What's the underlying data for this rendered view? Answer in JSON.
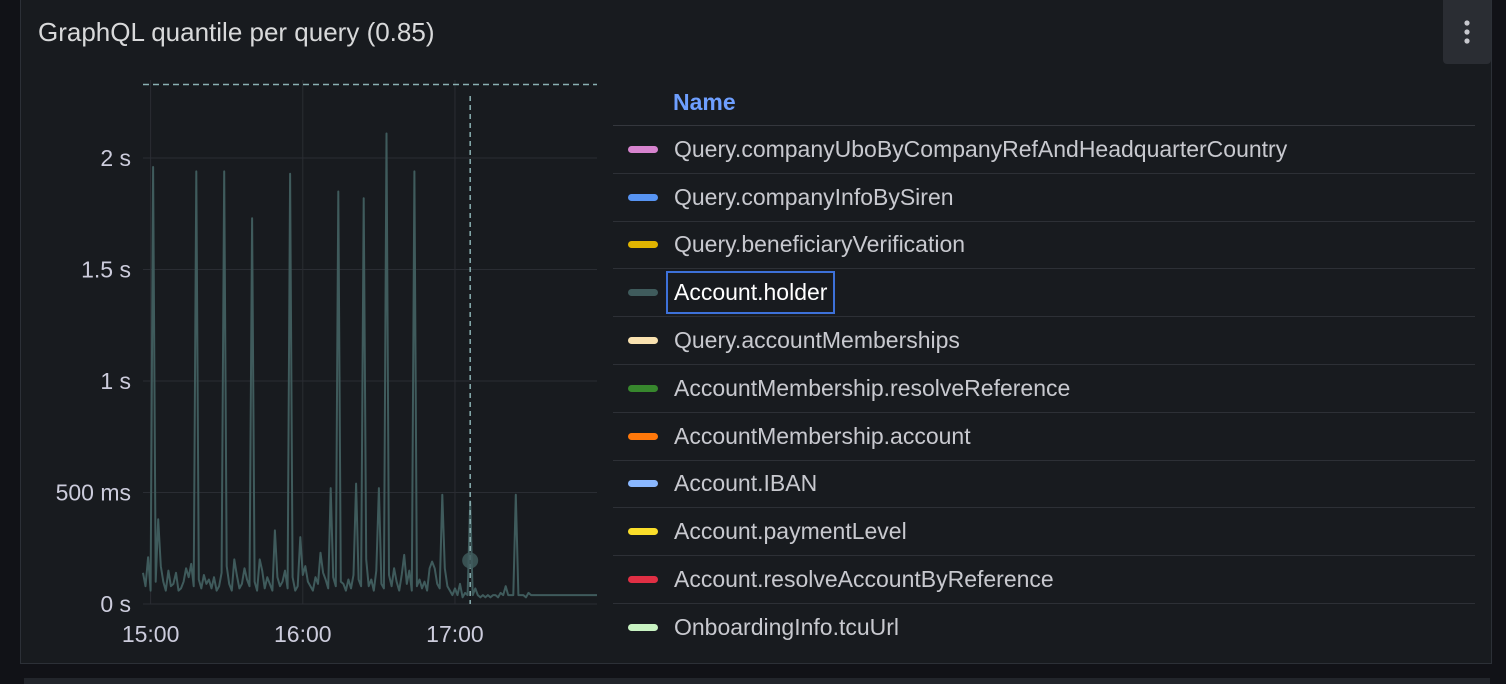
{
  "panel": {
    "title": "GraphQL quantile per query (0.85)",
    "menu_icon": "kebab-vertical-icon"
  },
  "legend": {
    "header": "Name",
    "items": [
      {
        "label": "Query.companyUboByCompanyRefAndHeadquarterCountry",
        "color": "#d683ce"
      },
      {
        "label": "Query.companyInfoBySiren",
        "color": "#5794f2"
      },
      {
        "label": "Query.beneficiaryVerification",
        "color": "#e0b400"
      },
      {
        "label": "Account.holder",
        "color": "#3f5b5c",
        "focused": true
      },
      {
        "label": "Query.accountMemberships",
        "color": "#f9e2b0"
      },
      {
        "label": "AccountMembership.resolveReference",
        "color": "#37872d"
      },
      {
        "label": "AccountMembership.account",
        "color": "#ff780a"
      },
      {
        "label": "Account.IBAN",
        "color": "#8ab8ff"
      },
      {
        "label": "Account.paymentLevel",
        "color": "#fade2a"
      },
      {
        "label": "Account.resolveAccountByReference",
        "color": "#e02f44"
      },
      {
        "label": "OnboardingInfo.tcuUrl",
        "color": "#c8f2c2"
      }
    ]
  },
  "chart_data": {
    "type": "line",
    "ylabel": "",
    "xlabel": "",
    "y_ticks": [
      "0 s",
      "500 ms",
      "1 s",
      "1.5 s",
      "2 s"
    ],
    "y_tick_values_ms": [
      0,
      500,
      1000,
      1500,
      2000
    ],
    "x_ticks": [
      "15:00",
      "16:00",
      "17:00"
    ],
    "ylim_ms": [
      0,
      2350
    ],
    "xlim": [
      "14:57",
      "17:57"
    ],
    "grid": true,
    "threshold_ms": 2330,
    "cursor_time": "17:06",
    "cursor_value_ms": 195,
    "series": [
      {
        "name": "Account.holder",
        "color": "#3f5b5c",
        "time_min": [
          0,
          1,
          2,
          3,
          4,
          5,
          6,
          7,
          8,
          9,
          10,
          11,
          12,
          13,
          14,
          15,
          16,
          17,
          18,
          19,
          20,
          21,
          22,
          23,
          24,
          25,
          26,
          27,
          28,
          29,
          30,
          31,
          32,
          33,
          34,
          35,
          36,
          37,
          38,
          39,
          40,
          41,
          42,
          43,
          44,
          45,
          46,
          47,
          48,
          49,
          50,
          51,
          52,
          53,
          54,
          55,
          56,
          57,
          58,
          59,
          60,
          61,
          62,
          63,
          64,
          65,
          66,
          67,
          68,
          69,
          70,
          71,
          72,
          73,
          74,
          75,
          76,
          77,
          78,
          79,
          80,
          81,
          82,
          83,
          84,
          85,
          86,
          87,
          88,
          89,
          90,
          91,
          92,
          93,
          94,
          95,
          96,
          97,
          98,
          99,
          100,
          101,
          102,
          103,
          104,
          105,
          106,
          107,
          108,
          109,
          110,
          111,
          112,
          113,
          114,
          115,
          116,
          117,
          118,
          119,
          120,
          121,
          122,
          123,
          124,
          125,
          126,
          127,
          128,
          129,
          130,
          131,
          132,
          133,
          134,
          135,
          136,
          137,
          138,
          139,
          140,
          141,
          142,
          143,
          144,
          145,
          146,
          147,
          148,
          149,
          150,
          151,
          152,
          153,
          154,
          155,
          156,
          157,
          158,
          159,
          160,
          161,
          162,
          163,
          164,
          165,
          166,
          167,
          168,
          169,
          170,
          171,
          172,
          173,
          174,
          175,
          176,
          177,
          178,
          179
        ],
        "values_ms": [
          140,
          80,
          210,
          60,
          1960,
          100,
          380,
          170,
          100,
          60,
          150,
          80,
          90,
          140,
          60,
          70,
          100,
          160,
          120,
          180,
          80,
          1940,
          110,
          70,
          130,
          90,
          110,
          70,
          120,
          60,
          80,
          140,
          1940,
          170,
          90,
          60,
          200,
          130,
          70,
          90,
          160,
          110,
          80,
          1730,
          100,
          60,
          200,
          150,
          70,
          120,
          90,
          60,
          330,
          120,
          80,
          100,
          150,
          70,
          1930,
          120,
          60,
          80,
          300,
          130,
          170,
          100,
          80,
          60,
          120,
          90,
          230,
          140,
          110,
          70,
          520,
          120,
          80,
          1850,
          100,
          90,
          60,
          110,
          70,
          130,
          540,
          110,
          80,
          1820,
          200,
          80,
          110,
          60,
          150,
          520,
          90,
          70,
          2110,
          130,
          80,
          160,
          100,
          60,
          130,
          220,
          90,
          150,
          60,
          1940,
          80,
          110,
          70,
          100,
          60,
          160,
          190,
          160,
          90,
          70,
          490,
          160,
          80,
          60,
          40,
          70,
          40,
          90,
          30,
          50,
          40,
          460,
          40,
          70,
          40,
          30,
          40,
          30,
          40,
          30,
          40,
          40,
          30,
          50,
          40,
          80,
          40,
          40,
          40,
          490,
          40,
          40,
          40,
          30,
          50,
          40,
          40,
          40,
          40,
          40,
          40,
          40,
          40,
          40,
          40,
          40,
          40,
          40,
          40,
          40,
          40,
          40,
          40,
          40,
          40,
          40,
          40,
          40,
          40,
          40,
          40,
          40
        ]
      }
    ]
  }
}
